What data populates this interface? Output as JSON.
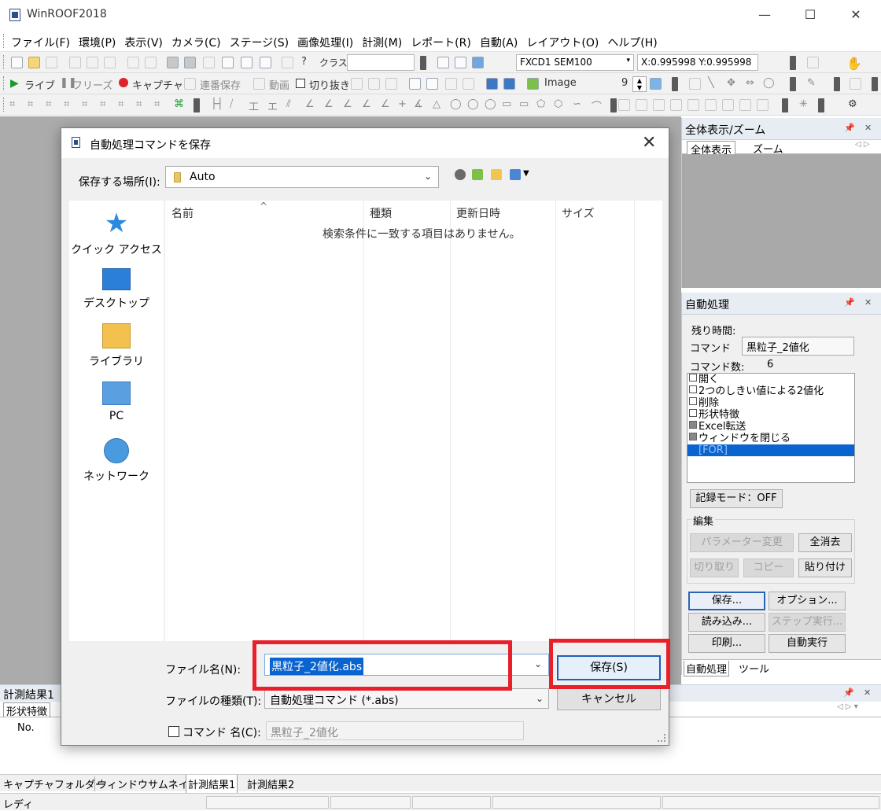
{
  "window": {
    "title": "WinROOF2018"
  },
  "window_controls": {
    "minimize": "—",
    "maximize": "☐",
    "close": "✕"
  },
  "menu": [
    "ファイル(F)",
    "環境(P)",
    "表示(V)",
    "カメラ(C)",
    "ステージ(S)",
    "画像処理(I)",
    "計測(M)",
    "レポート(R)",
    "自動(A)",
    "レイアウト(O)",
    "ヘルプ(H)"
  ],
  "toolbar1": {
    "class_label": "クラス",
    "calibration": "FXCD1 SEM100",
    "coords": "X:0.995998 Y:0.995998"
  },
  "toolbar2": {
    "live": "ライブ",
    "freeze": "フリーズ",
    "capture": "キャプチャ",
    "serial_save": "連番保存",
    "movie": "動画",
    "crop": "切り抜き",
    "image_label": "Image",
    "image_number": "9"
  },
  "zoom_panel": {
    "title": "全体表示/ズーム",
    "tabs": [
      "全体表示",
      "ズーム"
    ]
  },
  "auto_panel": {
    "title": "自動処理",
    "remaining_label": "残り時間:",
    "command_label": "コマンド",
    "command_value": "黒粒子_2値化",
    "count_label": "コマンド数:",
    "count_value": "6",
    "commands": [
      {
        "label": "開く",
        "checked_gray": false,
        "selected": false
      },
      {
        "label": "2つのしきい値による2値化",
        "checked_gray": false,
        "selected": false
      },
      {
        "label": "削除",
        "checked_gray": false,
        "selected": false
      },
      {
        "label": "形状特徴",
        "checked_gray": false,
        "selected": false
      },
      {
        "label": "Excel転送",
        "checked_gray": true,
        "selected": false
      },
      {
        "label": "ウィンドウを閉じる",
        "checked_gray": true,
        "selected": false
      },
      {
        "label": "[FOR]",
        "checked_gray": false,
        "selected": true
      }
    ],
    "record_mode": "記録モード：OFF",
    "edit_group": "編集",
    "buttons": {
      "param_change": "パラメーター変更",
      "clear_all": "全消去",
      "cut": "切り取り",
      "copy": "コピー",
      "paste": "貼り付け",
      "save": "保存...",
      "options": "オプション...",
      "load": "読み込み...",
      "step_run": "ステップ実行...",
      "print": "印刷...",
      "auto_run": "自動実行"
    },
    "tabs": [
      "自動処理",
      "ツール"
    ]
  },
  "measure_panel": {
    "title": "計測結果1",
    "tab": "形状特徴",
    "col_no": "No."
  },
  "bottom_tabs": [
    "キャプチャフォルダー",
    "ウィンドウサムネイル",
    "計測結果1",
    "計測結果2"
  ],
  "status": {
    "text": "レディ"
  },
  "dialog": {
    "title": "自動処理コマンドを保存",
    "location_label": "保存する場所(I):",
    "location_value": "Auto",
    "places": [
      "クイック アクセス",
      "デスクトップ",
      "ライブラリ",
      "PC",
      "ネットワーク"
    ],
    "columns": [
      "名前",
      "種類",
      "更新日時",
      "サイズ"
    ],
    "empty_message": "検索条件に一致する項目はありません。",
    "filename_label": "ファイル名(N):",
    "filename_value": "黒粒子_2値化.abs",
    "filetype_label": "ファイルの種類(T):",
    "filetype_value": "自動処理コマンド (*.abs)",
    "save_button": "保存(S)",
    "cancel_button": "キャンセル",
    "cmdname_label": "コマンド 名(C):",
    "cmdname_value": "黒粒子_2値化"
  },
  "colors": {
    "highlight": "#e8202a",
    "selection": "#0a64d0",
    "workspace": "#ababab"
  }
}
